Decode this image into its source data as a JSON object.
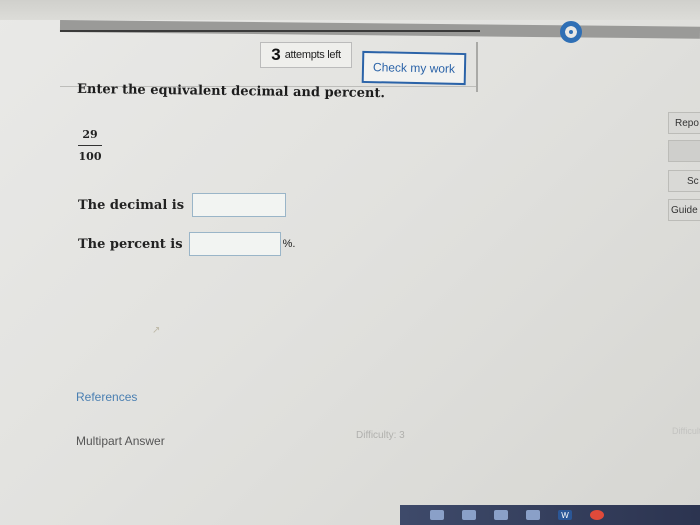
{
  "header": {
    "attempts_count": "3",
    "attempts_label": "attempts left",
    "check_button": "Check my work"
  },
  "question": {
    "prompt": "Enter the equivalent decimal and percent.",
    "numerator": "29",
    "denominator": "100",
    "decimal_label": "The decimal is",
    "decimal_value": "",
    "percent_label": "The percent is",
    "percent_value": "",
    "percent_suffix": "%."
  },
  "footer": {
    "references": "References",
    "multipart": "Multipart Answer",
    "difficulty": "Difficulty: 3",
    "side_faint": "Difficult"
  },
  "sidebar": {
    "report": "Repo",
    "sc": "Sc",
    "guide": "Guide"
  },
  "colors": {
    "accent": "#2b63a8",
    "link": "#4a7fb2"
  }
}
